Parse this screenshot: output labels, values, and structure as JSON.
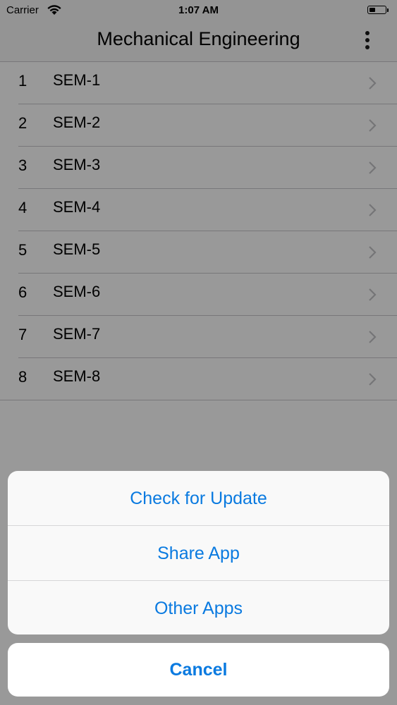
{
  "status_bar": {
    "carrier": "Carrier",
    "time": "1:07 AM",
    "battery_level_percent": 35
  },
  "nav": {
    "title": "Mechanical Engineering",
    "menu_icon": "more-vertical-icon"
  },
  "semesters": [
    {
      "num": "1",
      "label": "SEM-1"
    },
    {
      "num": "2",
      "label": "SEM-2"
    },
    {
      "num": "3",
      "label": "SEM-3"
    },
    {
      "num": "4",
      "label": "SEM-4"
    },
    {
      "num": "5",
      "label": "SEM-5"
    },
    {
      "num": "6",
      "label": "SEM-6"
    },
    {
      "num": "7",
      "label": "SEM-7"
    },
    {
      "num": "8",
      "label": "SEM-8"
    }
  ],
  "action_sheet": {
    "actions": [
      "Check for Update",
      "Share App",
      "Other Apps"
    ],
    "cancel": "Cancel"
  },
  "colors": {
    "accent": "#0a7ae0",
    "overlay": "rgba(0,0,0,0.40)"
  }
}
